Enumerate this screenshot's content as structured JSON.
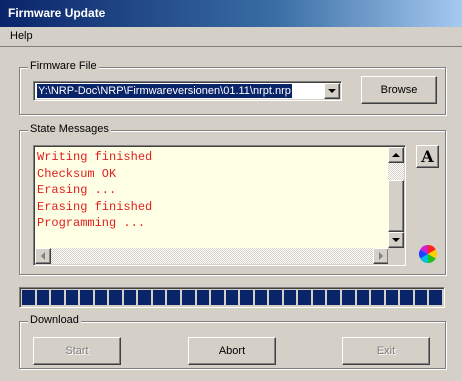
{
  "window": {
    "title": "Firmware Update"
  },
  "menu": {
    "items": [
      {
        "label": "Help"
      }
    ]
  },
  "firmware_file": {
    "group_label": "Firmware File",
    "path_value": "Y:\\NRP-Doc\\NRP\\Firmwareversionen\\01.11\\nrpt.nrp",
    "browse_label": "Browse"
  },
  "state_messages": {
    "group_label": "State Messages",
    "lines": [
      "Writing finished",
      "Checksum OK",
      "Erasing ...",
      "Erasing finished",
      "Programming ..."
    ],
    "text_color": "#e01e1e",
    "background_color": "#ffffe6",
    "font_button_label": "A"
  },
  "progress": {
    "fraction": 0.9,
    "segments_filled": 29,
    "bar_color": "#0a246a"
  },
  "download": {
    "group_label": "Download",
    "start_label": "Start",
    "abort_label": "Abort",
    "exit_label": "Exit"
  },
  "icons": {
    "font": "font-icon",
    "color": "color-wheel-icon",
    "dropdown": "chevron-down-icon"
  }
}
